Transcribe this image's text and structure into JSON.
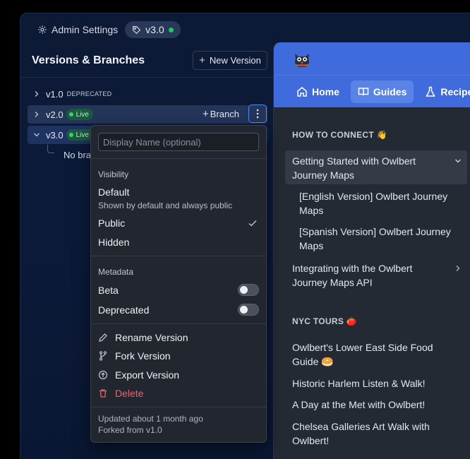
{
  "admin": {
    "title": "Admin Settings",
    "version_pill": "v3.0",
    "section_title": "Versions & Branches",
    "new_version_label": "New Version"
  },
  "versions": [
    {
      "name": "v1.0",
      "label": "DEPRECATED"
    },
    {
      "name": "v2.0",
      "badge": "Live",
      "branch_label": "Branch"
    },
    {
      "name": "v3.0",
      "badge": "Live",
      "empty_text": "No bra"
    }
  ],
  "menu": {
    "input_placeholder": "Display Name (optional)",
    "visibility_heading": "Visibility",
    "default_label": "Default",
    "default_desc": "Shown by default and always public",
    "public_label": "Public",
    "hidden_label": "Hidden",
    "metadata_heading": "Metadata",
    "beta_label": "Beta",
    "deprecated_label": "Deprecated",
    "rename_label": "Rename Version",
    "fork_label": "Fork Version",
    "export_label": "Export Version",
    "delete_label": "Delete",
    "updated_text": "Updated about 1 month ago",
    "forked_text": "Forked from v1.0"
  },
  "guides": {
    "nav": [
      {
        "label": "Home",
        "icon": "home-icon"
      },
      {
        "label": "Guides",
        "icon": "book-icon"
      },
      {
        "label": "Recipe",
        "icon": "flask-icon"
      }
    ],
    "section1_title": "HOW TO CONNECT 👋",
    "active_item": [
      "Getting Started with Owlbert",
      "Journey Maps"
    ],
    "sub_items": [
      [
        "[English Version] Owlbert Journey",
        "Maps"
      ],
      [
        "[Spanish Version] Owlbert Journey",
        "Maps"
      ]
    ],
    "integrating_item": [
      "Integrating with the Owlbert",
      "Journey Maps API"
    ],
    "section2_title": "NYC TOURS 🍅",
    "tours": [
      [
        "Owlbert's Lower East Side Food",
        "Guide 🥯"
      ],
      [
        "Historic Harlem Listen & Walk!"
      ],
      [
        "A Day at the Met with Owlbert!"
      ],
      [
        "Chelsea Galleries Art Walk with",
        "Owlbert!"
      ]
    ]
  },
  "colors": {
    "accent": "#3f6bdc",
    "live": "#22c55e",
    "danger": "#f0606a"
  }
}
